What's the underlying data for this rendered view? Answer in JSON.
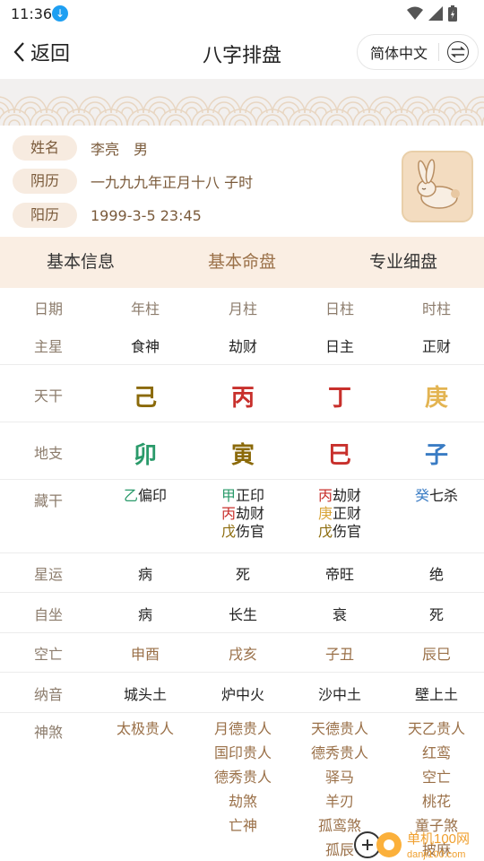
{
  "status": {
    "time": "11:36"
  },
  "nav": {
    "back_label": "返回",
    "title": "八字排盘",
    "language": "简体中文"
  },
  "info": {
    "name_label": "姓名",
    "name_value": "李亮　男",
    "lunar_label": "阴历",
    "lunar_value": "一九九九年正月十八 子时",
    "solar_label": "阳历",
    "solar_value": "1999-3-5 23:45"
  },
  "tabs": [
    "基本信息",
    "基本命盘",
    "专业细盘"
  ],
  "active_tab": 1,
  "table": {
    "header": [
      "日期",
      "年柱",
      "月柱",
      "日柱",
      "时柱"
    ],
    "zhuxing": {
      "label": "主星",
      "values": [
        "食神",
        "劫财",
        "日主",
        "正财"
      ]
    },
    "tiangan": {
      "label": "天干",
      "values": [
        "己",
        "丙",
        "丁",
        "庚"
      ],
      "colors": [
        "#8b6a0a",
        "#c8302c",
        "#c8302c",
        "#e3b452"
      ]
    },
    "dizhi": {
      "label": "地支",
      "values": [
        "卯",
        "寅",
        "巳",
        "子"
      ],
      "colors": [
        "#2a9a6a",
        "#8b6a0a",
        "#c8302c",
        "#3a7cc4"
      ]
    },
    "canggan": {
      "label": "藏干",
      "values": [
        [
          {
            "g": "乙",
            "c": "#2a9a6a",
            "t": "偏印"
          }
        ],
        [
          {
            "g": "甲",
            "c": "#2a9a6a",
            "t": "正印"
          },
          {
            "g": "丙",
            "c": "#c8302c",
            "t": "劫财"
          },
          {
            "g": "戊",
            "c": "#8b6a0a",
            "t": "伤官"
          }
        ],
        [
          {
            "g": "丙",
            "c": "#c8302c",
            "t": "劫财"
          },
          {
            "g": "庚",
            "c": "#d9a53a",
            "t": "正财"
          },
          {
            "g": "戊",
            "c": "#8b6a0a",
            "t": "伤官"
          }
        ],
        [
          {
            "g": "癸",
            "c": "#3a7cc4",
            "t": "七杀"
          }
        ]
      ]
    },
    "xingyun": {
      "label": "星运",
      "values": [
        "病",
        "死",
        "帝旺",
        "绝"
      ]
    },
    "zizuo": {
      "label": "自坐",
      "values": [
        "病",
        "长生",
        "衰",
        "死"
      ]
    },
    "kongwang": {
      "label": "空亡",
      "values": [
        "申酉",
        "戌亥",
        "子丑",
        "辰巳"
      ]
    },
    "nayin": {
      "label": "纳音",
      "values": [
        "城头土",
        "炉中火",
        "沙中土",
        "壁上土"
      ]
    },
    "shensha": {
      "label": "神煞",
      "values": [
        [
          "太极贵人"
        ],
        [
          "月德贵人",
          "国印贵人",
          "德秀贵人",
          "劫煞",
          "亡神"
        ],
        [
          "天德贵人",
          "德秀贵人",
          "驿马",
          "羊刃",
          "孤鸾煞",
          "孤辰"
        ],
        [
          "天乙贵人",
          "红鸾",
          "空亡",
          "桃花",
          "童子煞",
          "披麻"
        ]
      ]
    }
  },
  "watermark": {
    "text": "单机100网",
    "sub": "danji100.com"
  }
}
